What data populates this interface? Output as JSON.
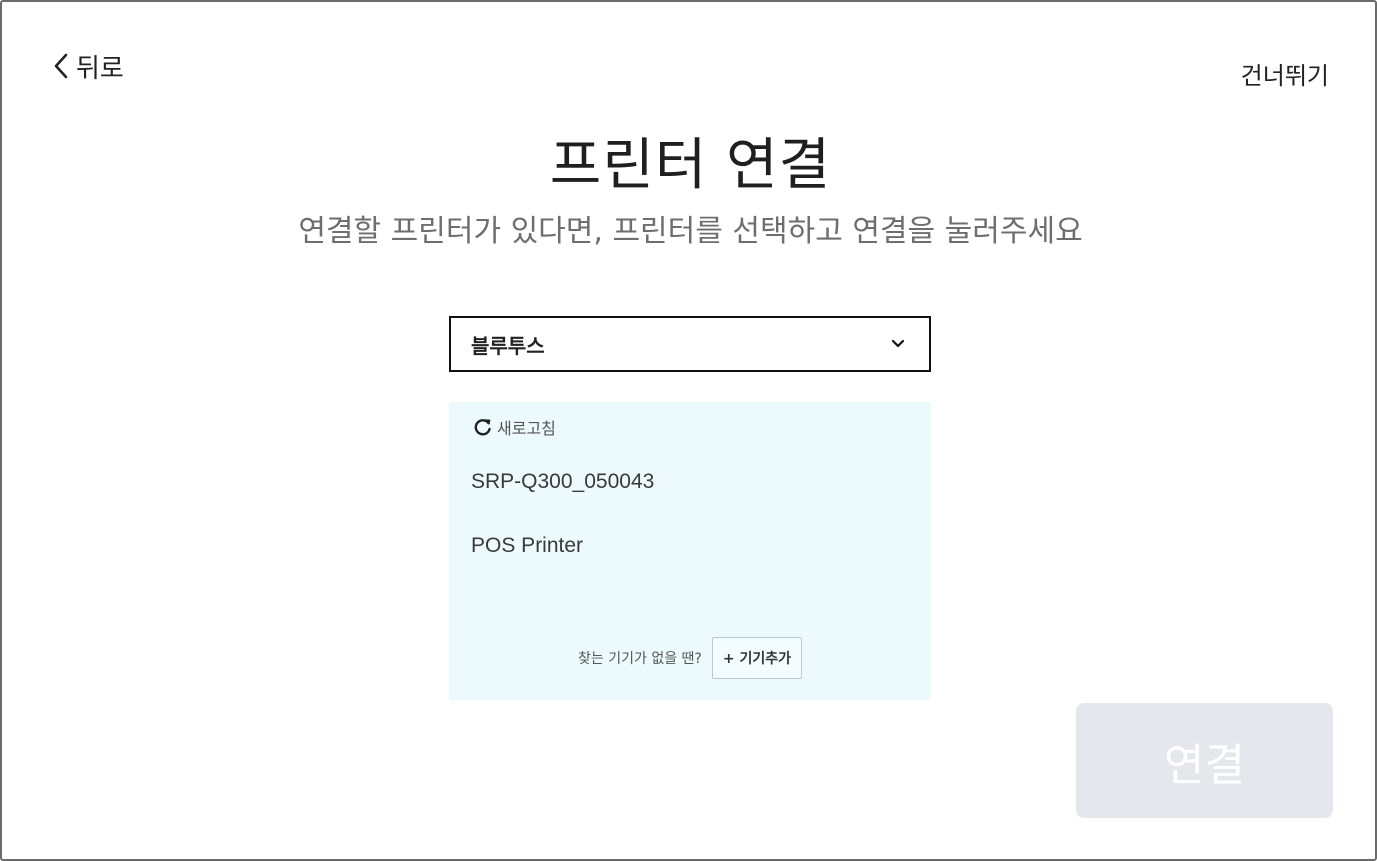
{
  "header": {
    "back_label": "뒤로",
    "skip_label": "건너뛰기"
  },
  "page": {
    "title": "프린터 연결",
    "subtitle": "연결할 프린터가 있다면, 프린터를 선택하고 연결을 눌러주세요"
  },
  "connection_type": {
    "selected": "블루투스",
    "icon": "chevron-down-icon"
  },
  "device_panel": {
    "refresh_label": "새로고침",
    "refresh_icon": "refresh-icon",
    "devices": [
      {
        "name": "SRP-Q300_050043"
      },
      {
        "name": "POS Printer"
      }
    ],
    "help_text": "찾는 기기가 없을 땐?",
    "add_device_label": "+ 기기추가",
    "background_color": "#ecfafd"
  },
  "actions": {
    "connect_label": "연결",
    "connect_disabled": true
  }
}
